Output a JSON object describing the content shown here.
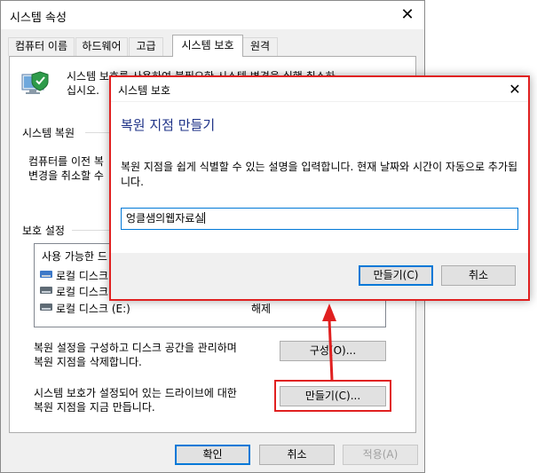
{
  "window": {
    "title": "시스템 속성",
    "close_glyph": "✕",
    "tabs": [
      {
        "label": "컴퓨터 이름"
      },
      {
        "label": "하드웨어"
      },
      {
        "label": "고급"
      },
      {
        "label": "시스템 보호"
      },
      {
        "label": "원격"
      }
    ],
    "intro_text_line1": "시스템 보호를 사용하여 불필요한 시스템 변경을 실행 취소하",
    "intro_text_line2": "십시오.",
    "restore_section": {
      "heading": "시스템 복원",
      "text_line1": "컴퓨터를 이전 복",
      "text_line2": "변경을 취소할 수"
    },
    "protection_section": {
      "heading": "보호 설정",
      "list_header": "사용 가능한 드",
      "drives": [
        {
          "name": "로컬 디스크",
          "status": ""
        },
        {
          "name": "로컬 디스크",
          "status": ""
        },
        {
          "name": "로컬 디스크 (E:)",
          "status": "해제"
        }
      ]
    },
    "configure_text_line1": "복원 설정을 구성하고 디스크 공간을 관리하며",
    "configure_text_line2": "복원 지점을 삭제합니다.",
    "configure_button": "구성(O)...",
    "create_text_line1": "시스템 보호가 설정되어 있는 드라이브에 대한",
    "create_text_line2": "복원 지점을 지금 만듭니다.",
    "create_button": "만들기(C)...",
    "ok_button": "확인",
    "cancel_button": "취소",
    "apply_button": "적용(A)"
  },
  "dialog": {
    "title": "시스템 보호",
    "close_glyph": "✕",
    "heading": "복원 지점 만들기",
    "description": "복원 지점을 쉽게 식별할 수 있는 설명을 입력합니다. 현재 날짜와 시간이 자동으로 추가됩니다.",
    "input_value": "엉클샘의웹자료실",
    "create_button": "만들기(C)",
    "cancel_button": "취소"
  },
  "colors": {
    "highlight": "#e02020",
    "accent": "#0078d7",
    "heading_blue": "#1e3287"
  }
}
